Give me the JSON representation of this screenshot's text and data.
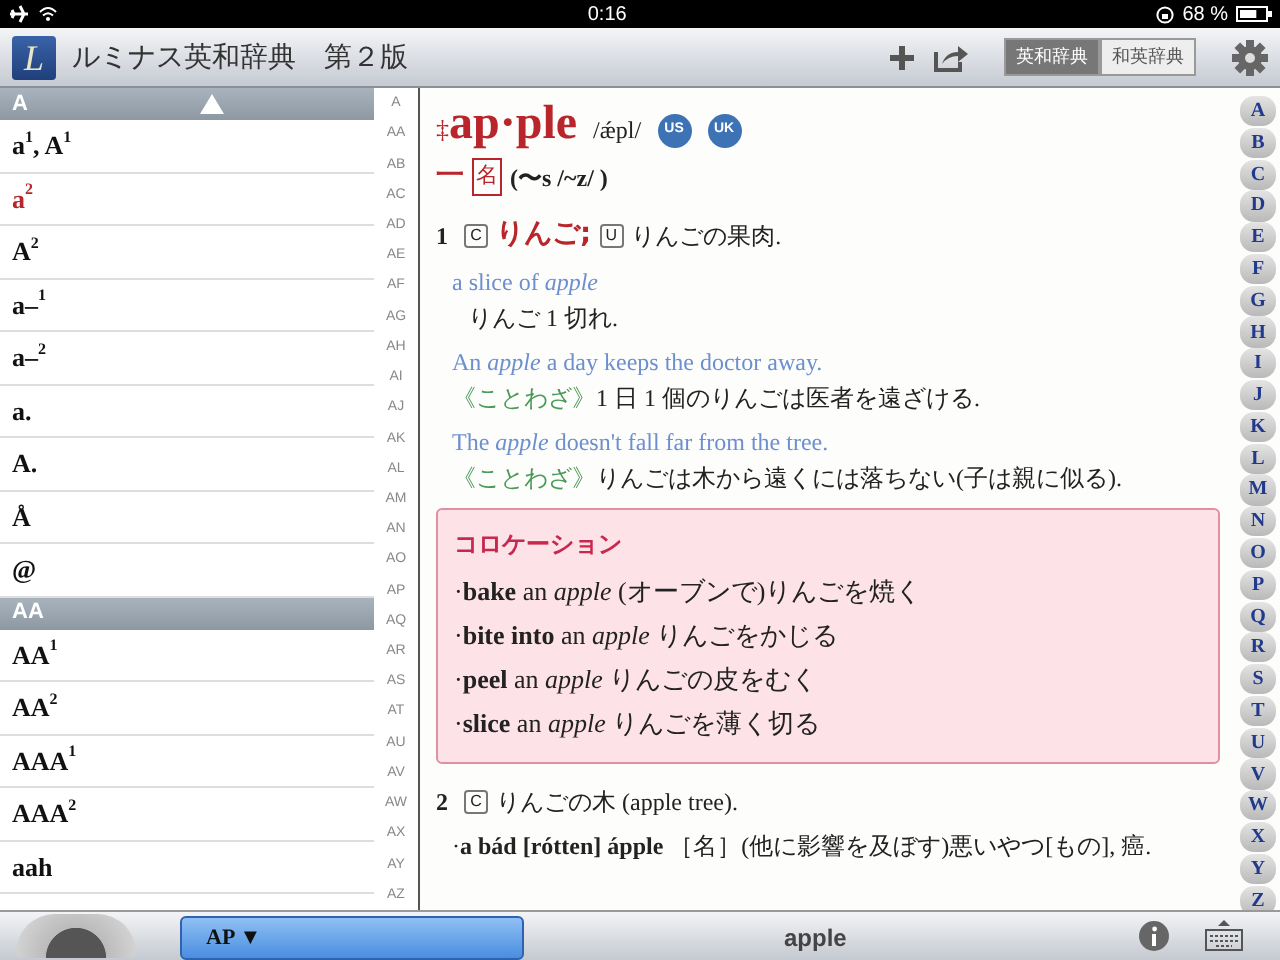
{
  "status_bar": {
    "time": "0:16",
    "battery": "68 %",
    "level": 0.68
  },
  "toolbar": {
    "logo": "L",
    "title": "ルミナス英和辞典　第２版",
    "tabs": [
      {
        "label": "英和辞典",
        "selected": true
      },
      {
        "label": "和英辞典",
        "selected": false
      }
    ]
  },
  "word_list": {
    "sections": [
      {
        "header": "A",
        "entries": [
          {
            "text": "a$^{1}$, A$^{1}$",
            "selected": false
          },
          {
            "text": "a$^{2}$",
            "selected": true
          },
          {
            "text": "A$^{2}$",
            "selected": false
          },
          {
            "text": "a–$^{1}$",
            "selected": false
          },
          {
            "text": "a–$^{2}$",
            "selected": false
          },
          {
            "text": "a.",
            "selected": false
          },
          {
            "text": "A.",
            "selected": false
          },
          {
            "text": "Å",
            "selected": false
          },
          {
            "text": "@",
            "selected": false
          }
        ]
      },
      {
        "header": "AA",
        "entries": [
          {
            "text": "AA$^{1}$",
            "selected": false
          },
          {
            "text": "AA$^{2}$",
            "selected": false
          },
          {
            "text": "AAA$^{1}$",
            "selected": false
          },
          {
            "text": "AAA$^{2}$",
            "selected": false
          },
          {
            "text": "aah",
            "selected": false
          }
        ]
      }
    ],
    "index": [
      "A",
      "AA",
      "AB",
      "AC",
      "AD",
      "AE",
      "AF",
      "AG",
      "AH",
      "AI",
      "AJ",
      "AK",
      "AL",
      "AM",
      "AN",
      "AO",
      "AP",
      "AQ",
      "AR",
      "AS",
      "AT",
      "AU",
      "AV",
      "AW",
      "AX",
      "AY",
      "AZ"
    ]
  },
  "entry": {
    "mark": "‡",
    "headword": "ap·ple",
    "pronunciation": "/ǽpl/",
    "audio": [
      "US",
      "UK"
    ],
    "pos_line": {
      "dash": "一",
      "pos": "名",
      "inflection": "(〜s /~z/ )"
    },
    "senses": [
      {
        "number": "1",
        "parts": [
          {
            "kind": "label",
            "text": "C"
          },
          {
            "kind": "main",
            "text": "りんご;"
          },
          {
            "kind": "label",
            "text": "U"
          },
          {
            "kind": "plain",
            "text": "りんごの果肉."
          }
        ],
        "examples": [
          {
            "english": "a slice of *apple*",
            "japanese": "りんご 1 切れ."
          },
          {
            "english": "An *apple* a day keeps the doctor away.",
            "tag": "《ことわざ》",
            "japanese": "1 日 1 個のりんごは医者を遠ざける."
          },
          {
            "english": "The *apple* doesn't fall far from the tree.",
            "tag": "《ことわざ》",
            "japanese": "りんごは木から遠くには落ちない(子は親に似る)."
          }
        ],
        "collocation": {
          "title": "コロケーション",
          "items": [
            "·**bake** an *apple* (オーブンで)りんごを焼く",
            "·**bite into** an *apple* りんごをかじる",
            "·**peel** an *apple* りんごの皮をむく",
            "·**slice** an *apple* りんごを薄く切る"
          ]
        }
      },
      {
        "number": "2",
        "parts": [
          {
            "kind": "label",
            "text": "C"
          },
          {
            "kind": "plain",
            "text": "りんごの木 (apple tree)."
          }
        ],
        "phrases": [
          "·**a bád [rótten] ápple** ［名］(他に影響を及ぼす)悪いやつ[もの], 癌."
        ]
      }
    ]
  },
  "alphabet": [
    "A",
    "B",
    "C",
    "D",
    "E",
    "F",
    "G",
    "H",
    "I",
    "J",
    "K",
    "L",
    "M",
    "N",
    "O",
    "P",
    "Q",
    "R",
    "S",
    "T",
    "U",
    "V",
    "W",
    "X",
    "Y",
    "Z"
  ],
  "bottom_bar": {
    "jump": "AP ▼",
    "search_word": "apple"
  }
}
